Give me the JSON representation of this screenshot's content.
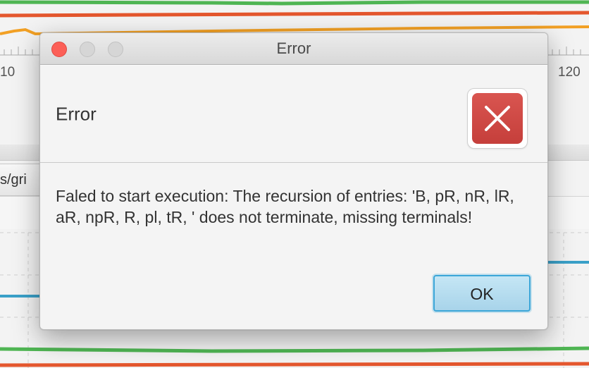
{
  "background": {
    "tick_left": "10",
    "tick_right": "120",
    "path_fragment": "s/gri",
    "line_colors": {
      "green": "#4fb553",
      "red": "#e4572e",
      "orange": "#f2a024",
      "blue": "#3aa0c8"
    }
  },
  "dialog": {
    "window_title": "Error",
    "header_text": "Error",
    "icon": "error-x-icon",
    "message": "Faled to start execution: The recursion of entries: 'B, pR, nR, lR, aR, npR, R, pl, tR, ' does not terminate, missing terminals!",
    "ok_label": "OK",
    "accent_color": "#3ca6d8",
    "error_color": "#cc4541"
  }
}
